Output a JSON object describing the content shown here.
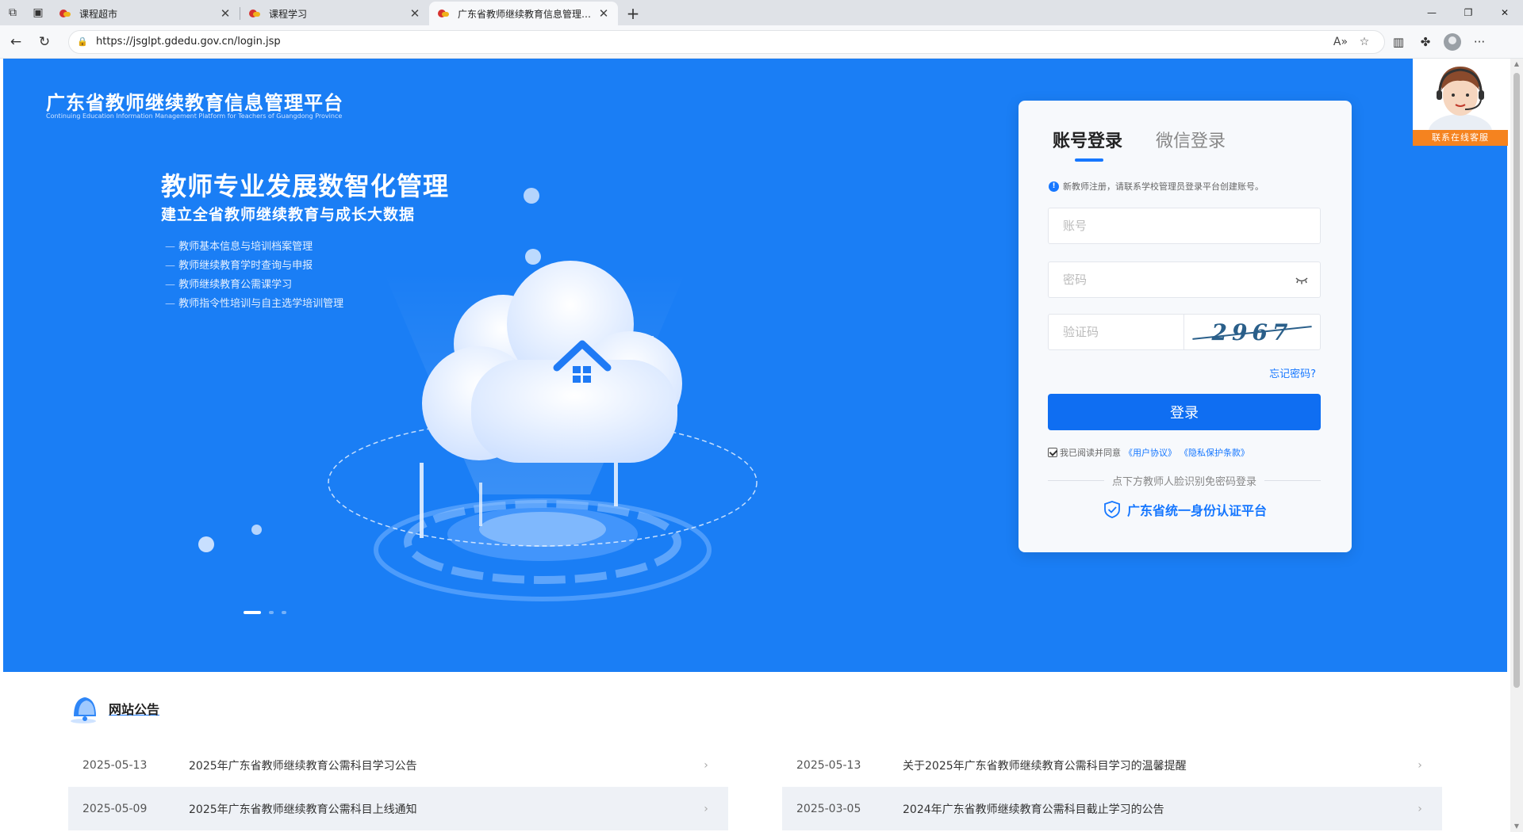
{
  "browser": {
    "tabs": [
      {
        "title": "课程超市"
      },
      {
        "title": "课程学习"
      },
      {
        "title": "广东省教师继续教育信息管理平台"
      }
    ],
    "url": "https://jsglpt.gdedu.gov.cn/login.jsp"
  },
  "site": {
    "title": "广东省教师继续教育信息管理平台",
    "subtitle": "Continuing Education Information Management Platform for Teachers of Guangdong Province"
  },
  "hero": {
    "slogan_main": "教师专业发展数智化管理",
    "slogan_sub": "建立全省教师继续教育与成长大数据",
    "features": [
      "教师基本信息与培训档案管理",
      "教师继续教育学时查询与申报",
      "教师继续教育公需课学习",
      "教师指令性培训与自主选学培训管理"
    ]
  },
  "login": {
    "tab_account": "账号登录",
    "tab_wechat": "微信登录",
    "notice": "新教师注册，请联系学校管理员登录平台创建账号。",
    "account_placeholder": "账号",
    "password_placeholder": "密码",
    "captcha_placeholder": "验证码",
    "captcha_text": "2967",
    "forgot": "忘记密码?",
    "submit": "登录",
    "agree_text": "我已阅读并同意",
    "user_agreement": "《用户协议》",
    "privacy": "《隐私保护条款》",
    "face_login_hint": "点下方教师人脸识别免密码登录",
    "unified_auth": "广东省统一身份认证平台"
  },
  "service": {
    "label": "联系在线客服"
  },
  "announcements": {
    "title": "网站公告",
    "left": [
      {
        "date": "2025-05-13",
        "title": "2025年广东省教师继续教育公需科目学习公告"
      },
      {
        "date": "2025-05-09",
        "title": "2025年广东省教师继续教育公需科目上线通知"
      }
    ],
    "right": [
      {
        "date": "2025-05-13",
        "title": "关于2025年广东省教师继续教育公需科目学习的温馨提醒"
      },
      {
        "date": "2025-03-05",
        "title": "2024年广东省教师继续教育公需科目截止学习的公告"
      }
    ]
  },
  "colors": {
    "hero_bg": "#1a7ef5",
    "primary": "#1677ff",
    "service_orange": "#f5831f"
  }
}
